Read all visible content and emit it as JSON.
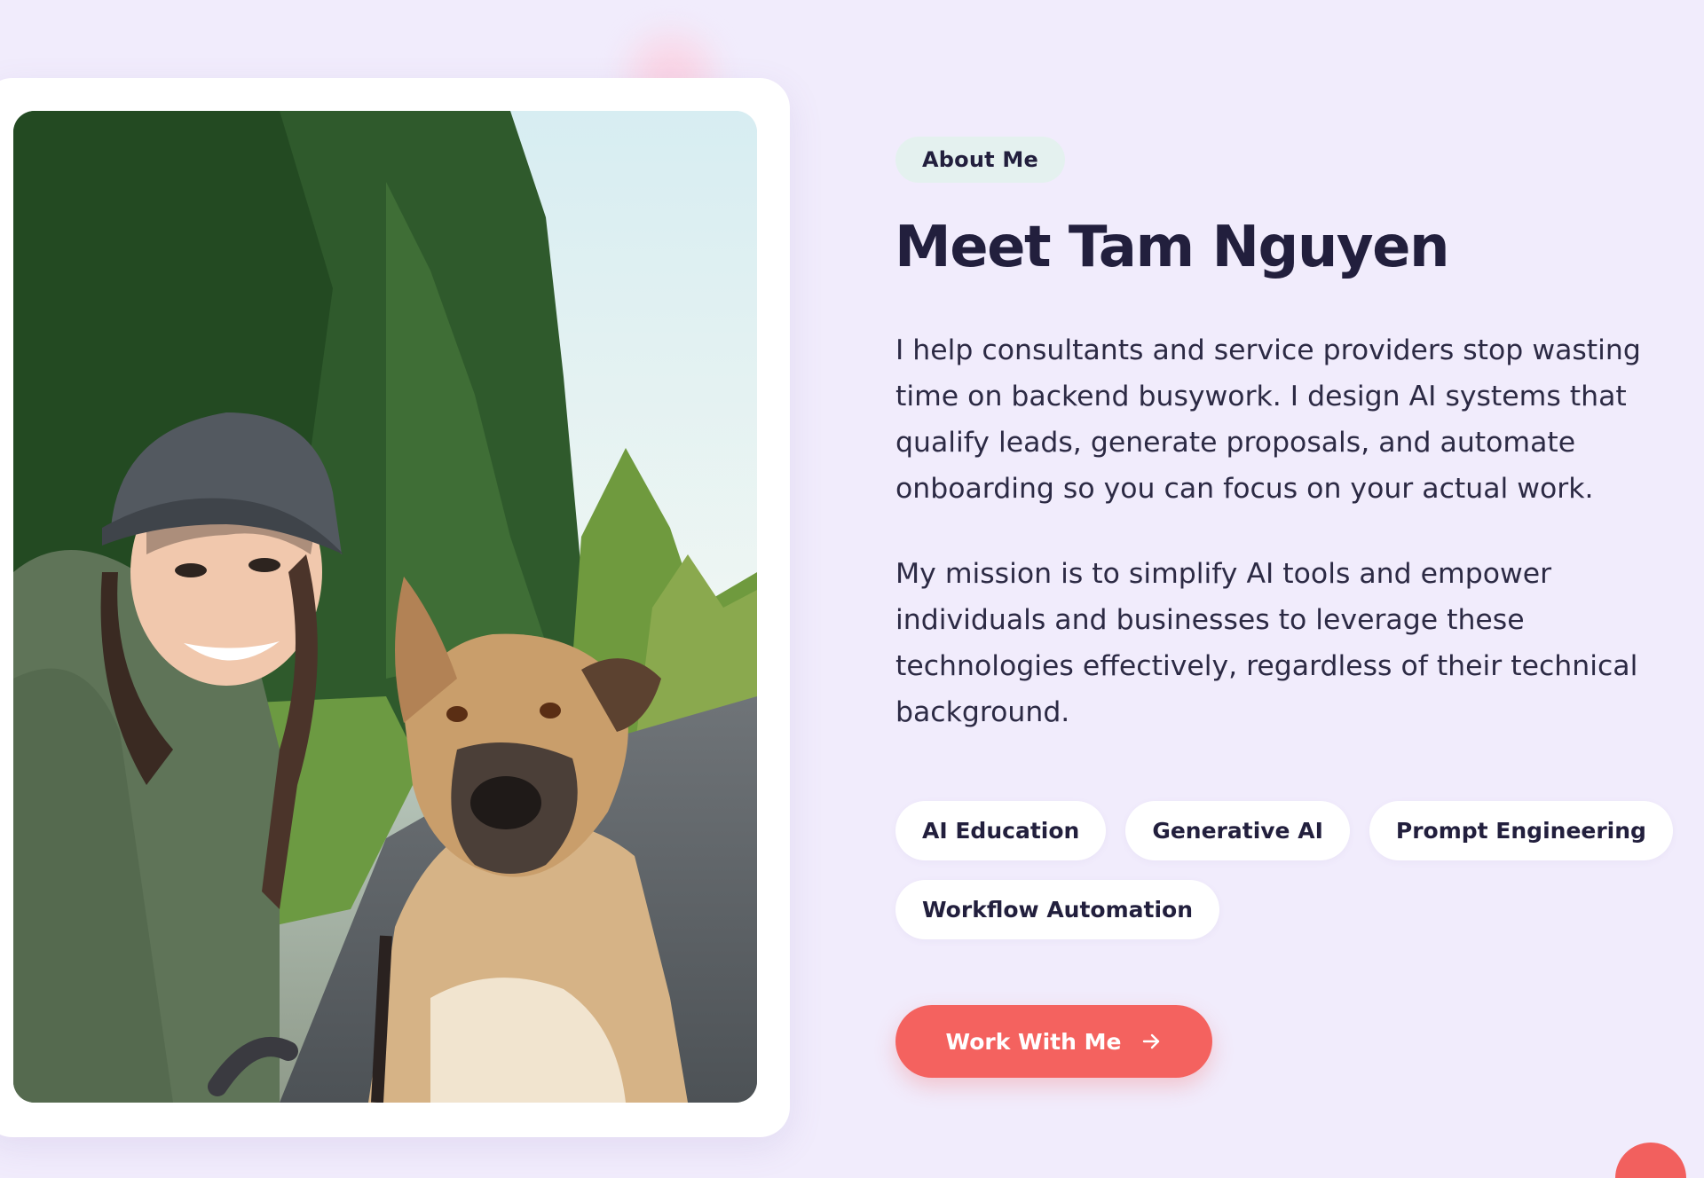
{
  "about": {
    "pill_label": "About Me",
    "title": "Meet Tam Nguyen",
    "paragraphs": [
      "I help consultants and service providers stop wasting time on backend busywork. I design AI systems that qualify leads, generate proposals, and automate onboarding so you can focus on your actual work.",
      "My mission is to simplify AI tools and empower individuals and businesses to leverage these technologies effectively, regardless of their technical background."
    ],
    "tags": [
      "AI Education",
      "Generative AI",
      "Prompt Engineering",
      "Workflow Automation"
    ],
    "cta_label": "Work With Me",
    "cta_icon": "arrow-right-icon"
  },
  "photo": {
    "subject": "profile-photo"
  },
  "colors": {
    "background": "#f1ecfc",
    "pill_background": "#e4f1ef",
    "heading": "#221f3d",
    "cta": "#f4625f",
    "tag_background": "#ffffff"
  }
}
